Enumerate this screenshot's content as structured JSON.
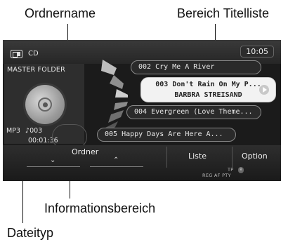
{
  "callouts": {
    "ordnername": "Ordnername",
    "bereich_titelliste": "Bereich Titelliste",
    "informationsbereich": "Informationsbereich",
    "dateityp": "Dateityp"
  },
  "header": {
    "source_icon": "cd-source-icon",
    "source_label": "CD",
    "clock": "10:05"
  },
  "folder": {
    "name": "MASTER FOLDER",
    "disc_icon": "disc-icon"
  },
  "info": {
    "file_type": "MP3",
    "track_number": "♪003",
    "elapsed": "00:01:36"
  },
  "tracks": [
    {
      "label": "002 Cry Me A River"
    },
    {
      "line1": "003 Don't Rain On My P...",
      "line2": "BARBRA STREISAND",
      "selected": true
    },
    {
      "label": "004 Evergreen (Love Theme..."
    },
    {
      "label": "005 Happy Days Are Here A..."
    }
  ],
  "bottom": {
    "folder_label": "Ordner",
    "down_arrow": "⌄",
    "up_arrow": "⌃",
    "list_label": "Liste",
    "option_label": "Option",
    "status_tp": "TP",
    "status_flags": "REG AF PTY"
  },
  "colors": {
    "screen_bg": "#1b1b1b",
    "selected_track_bg": "#f2f2f2",
    "text_light": "#e8e8e8"
  }
}
